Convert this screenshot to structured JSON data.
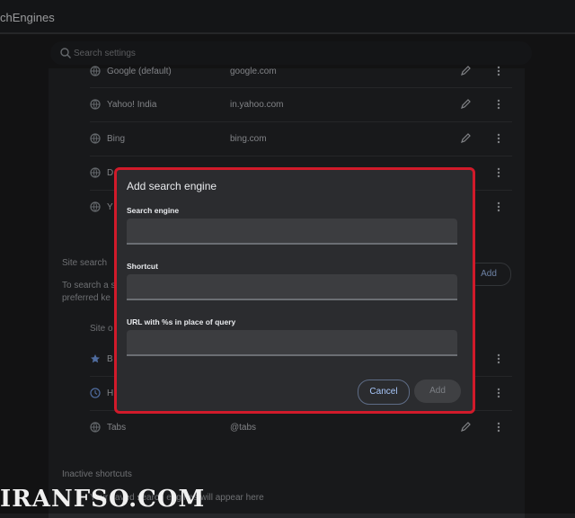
{
  "window": {
    "title": "chEngines"
  },
  "search": {
    "placeholder": "Search settings"
  },
  "engines": [
    {
      "name": "Google (default)",
      "domain": "google.com",
      "icon": "globe-icon"
    },
    {
      "name": "Yahoo! India",
      "domain": "in.yahoo.com",
      "icon": "globe-icon"
    },
    {
      "name": "Bing",
      "domain": "bing.com",
      "icon": "globe-icon"
    },
    {
      "name": "D",
      "domain": "",
      "icon": "globe-icon"
    },
    {
      "name": "Y",
      "domain": "",
      "icon": "globe-icon"
    }
  ],
  "site_search": {
    "heading": "Site search",
    "desc_line1": "To search a s",
    "desc_line2": "preferred ke",
    "add_label": "Add",
    "column": "Site o",
    "items": [
      {
        "name": "B",
        "domain": "",
        "icon": "star-icon"
      },
      {
        "name": "H",
        "domain": "",
        "icon": "clock-icon"
      },
      {
        "name": "Tabs",
        "domain": "@tabs",
        "icon": "globe-icon"
      }
    ]
  },
  "inactive": {
    "heading": "Inactive shortcuts",
    "empty": "Your saved search engines will appear here"
  },
  "dialog": {
    "title": "Add search engine",
    "field1_label": "Search engine",
    "field1_value": "",
    "field2_label": "Shortcut",
    "field2_value": "",
    "field3_label": "URL with %s in place of query",
    "field3_value": "",
    "cancel_label": "Cancel",
    "add_label": "Add"
  },
  "watermark": "IRANFSO.COM",
  "colors": {
    "dialog_border": "#d11a2a",
    "accent": "#a8c7fa",
    "background": "#1c1c1e"
  }
}
